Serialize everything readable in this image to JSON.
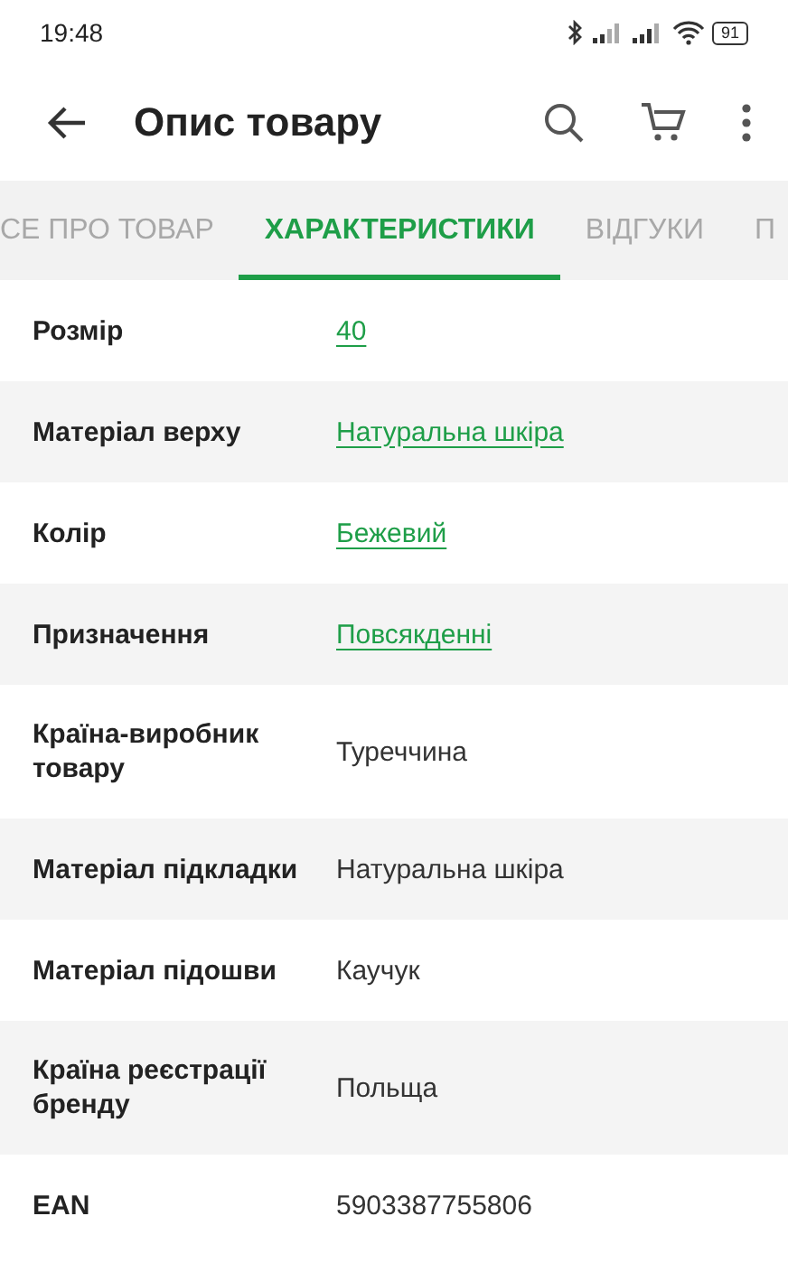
{
  "status_bar": {
    "time": "19:48",
    "battery": "91"
  },
  "app_bar": {
    "title": "Опис товару"
  },
  "tabs": [
    {
      "label": "СЕ ПРО ТОВАР",
      "selected": false
    },
    {
      "label": "ХАРАКТЕРИСТИКИ",
      "selected": true
    },
    {
      "label": "ВІДГУКИ",
      "selected": false
    },
    {
      "label": "П",
      "selected": false
    }
  ],
  "specs": [
    {
      "name": "Розмір",
      "value": "40",
      "link": true
    },
    {
      "name": "Матеріал верху",
      "value": "Натуральна шкіра",
      "link": true
    },
    {
      "name": "Колір",
      "value": "Бежевий",
      "link": true
    },
    {
      "name": "Призначення",
      "value": "Повсякденні",
      "link": true
    },
    {
      "name": "Країна-виробник товару",
      "value": "Туреччина",
      "link": false
    },
    {
      "name": "Матеріал підкладки",
      "value": "Натуральна шкіра",
      "link": false
    },
    {
      "name": "Матеріал підошви",
      "value": "Каучук",
      "link": false
    },
    {
      "name": "Країна реєстрації бренду",
      "value": "Польща",
      "link": false
    },
    {
      "name": "EAN",
      "value": "5903387755806",
      "link": false
    }
  ]
}
